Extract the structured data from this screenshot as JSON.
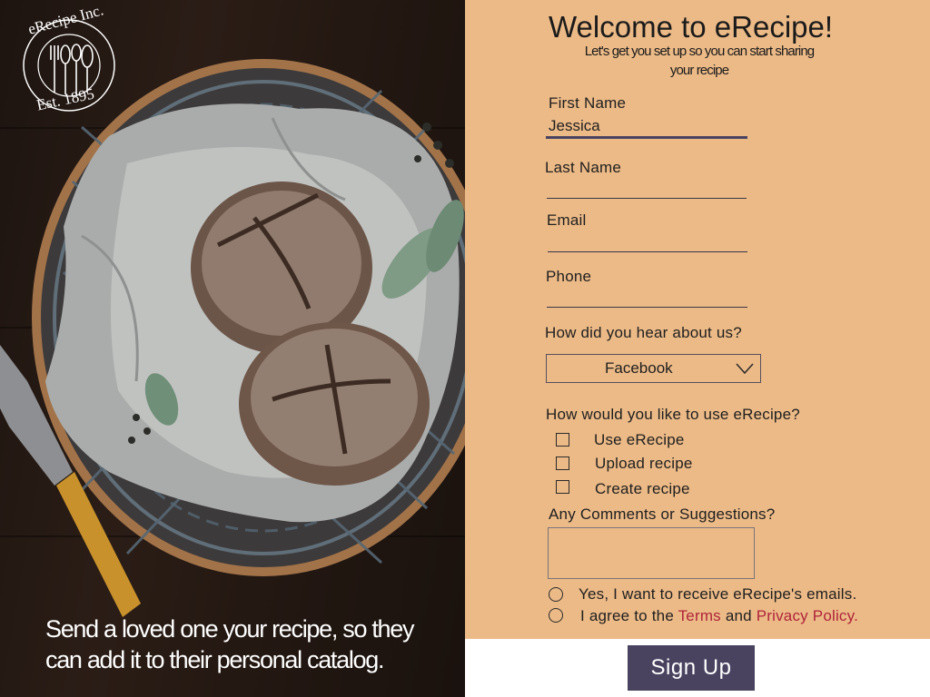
{
  "brand": {
    "logo_top": "eRecipe Inc.",
    "logo_bottom": "Est. 1895"
  },
  "hero": {
    "tagline_line1": "Send a loved one your recipe, so they",
    "tagline_line2": "can add it to their personal catalog."
  },
  "form": {
    "title": "Welcome to eRecipe!",
    "subtitle_line1": "Let's get you set up so you can start sharing",
    "subtitle_line2": "your recipe",
    "first_name": {
      "label": "First Name",
      "value": "Jessica"
    },
    "last_name": {
      "label": "Last Name",
      "value": ""
    },
    "email": {
      "label": "Email",
      "value": ""
    },
    "phone": {
      "label": "Phone",
      "value": ""
    },
    "hear_about": {
      "label": "How did you hear about us?",
      "selected": "Facebook"
    },
    "usage": {
      "label": "How would you like to use eRecipe?",
      "options": [
        "Use eRecipe",
        "Upload recipe",
        "Create recipe"
      ]
    },
    "comments": {
      "label": "Any Comments or Suggestions?",
      "value": ""
    },
    "emails_opt_in": "Yes, I want to receive eRecipe's emails.",
    "agree": {
      "prefix": "I agree to the",
      "terms": "Terms",
      "and": "and",
      "privacy": "Privacy Policy."
    },
    "submit_label": "Sign Up"
  },
  "colors": {
    "panel": "#ecba87",
    "button": "#4a4360",
    "link": "#b0243a"
  }
}
